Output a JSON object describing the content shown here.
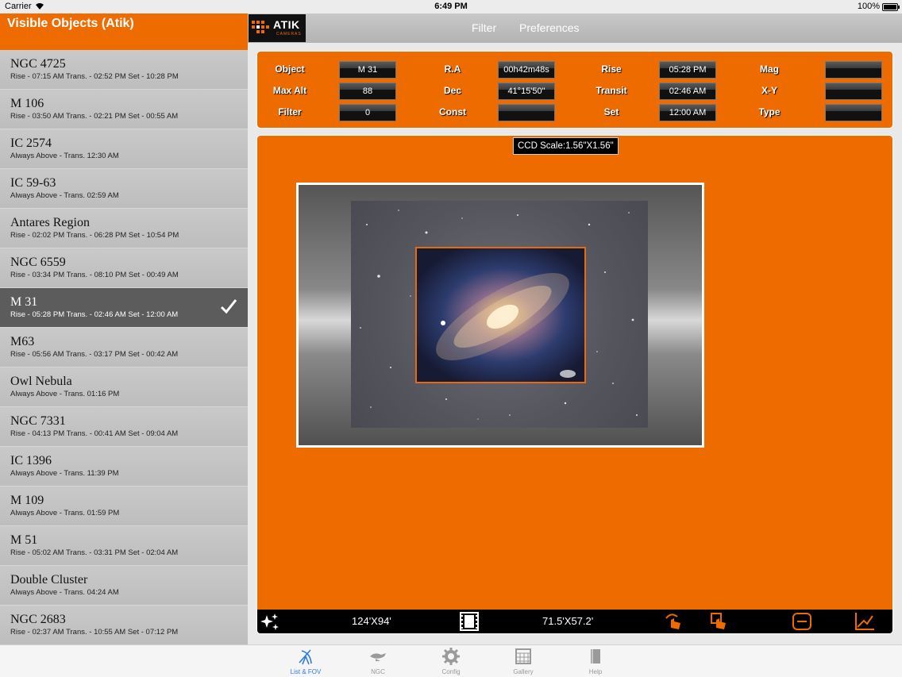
{
  "status_bar": {
    "carrier": "Carrier",
    "time": "6:49 PM",
    "battery": "100%"
  },
  "left_header": {
    "title": "Visible Objects (Atik)"
  },
  "objects": [
    {
      "name": "NGC 4725",
      "details": "Rise - 07:15 AM Trans. - 02:52 PM Set - 10:28 PM"
    },
    {
      "name": "M 106",
      "details": "Rise - 03:50 AM Trans. - 02:21 PM Set - 00:55 AM"
    },
    {
      "name": "IC 2574",
      "details": "Always Above - Trans. 12:30 AM"
    },
    {
      "name": "IC 59-63",
      "details": "Always Above - Trans. 02:59 AM"
    },
    {
      "name": "Antares Region",
      "details": "Rise - 02:02 PM Trans. - 06:28 PM Set - 10:54 PM"
    },
    {
      "name": "NGC 6559",
      "details": "Rise - 03:34 PM Trans. - 08:10 PM Set - 00:49 AM"
    },
    {
      "name": "M 31",
      "details": "Rise - 05:28 PM Trans. - 02:46 AM Set - 12:00 AM",
      "selected": true
    },
    {
      "name": "M63",
      "details": "Rise - 05:56 AM Trans. - 03:17 PM Set - 00:42 AM"
    },
    {
      "name": "Owl Nebula",
      "details": "Always Above - Trans. 01:16 PM"
    },
    {
      "name": "NGC 7331",
      "details": "Rise - 04:13 PM Trans. - 00:41 AM Set - 09:04 AM"
    },
    {
      "name": "IC 1396",
      "details": "Always Above - Trans. 11:39 PM"
    },
    {
      "name": "M 109",
      "details": "Always Above - Trans. 01:59 PM"
    },
    {
      "name": "M 51",
      "details": "Rise - 05:02 AM Trans. - 03:31 PM Set - 02:04 AM"
    },
    {
      "name": "Double Cluster",
      "details": "Always Above - Trans. 04:24 AM"
    },
    {
      "name": "NGC 2683",
      "details": "Rise - 02:37 AM Trans. - 10:55 AM Set - 07:12 PM"
    }
  ],
  "logo": {
    "word": "ATIK",
    "sub": "CAMERAS"
  },
  "top_menu": {
    "filter": "Filter",
    "preferences": "Preferences"
  },
  "info": {
    "object_label": "Object",
    "object_value": "M 31",
    "ra_label": "R.A",
    "ra_value": "00h42m48s",
    "rise_label": "Rise",
    "rise_value": "05:28 PM",
    "mag_label": "Mag",
    "mag_value": "",
    "maxalt_label": "Max Alt",
    "maxalt_value": "88",
    "dec_label": "Dec",
    "dec_value": "41°15'50\"",
    "transit_label": "Transit",
    "transit_value": "02:46 AM",
    "xy_label": "X-Y",
    "xy_value": "",
    "filter_label": "Filter",
    "filter_value": "0",
    "const_label": "Const",
    "const_value": "",
    "set_label": "Set",
    "set_value": "12:00 AM",
    "type_label": "Type",
    "type_value": ""
  },
  "fov": {
    "ccd_scale": "CCD Scale:1.56\"X1.56\"",
    "field_size": "124'X94'",
    "sensor_size": "71.5'X57.2'"
  },
  "tabs": [
    {
      "label": "List & FOV",
      "icon": "telescope-icon",
      "active": true
    },
    {
      "label": "NGC",
      "icon": "lamp-icon"
    },
    {
      "label": "Config",
      "icon": "gear-icon"
    },
    {
      "label": "Gallery",
      "icon": "calendar-grid-icon"
    },
    {
      "label": "Help",
      "icon": "book-icon"
    }
  ],
  "colors": {
    "accent": "#ee6b00",
    "selected_row": "#5c5c5c",
    "active_tab": "#2c7be5"
  }
}
